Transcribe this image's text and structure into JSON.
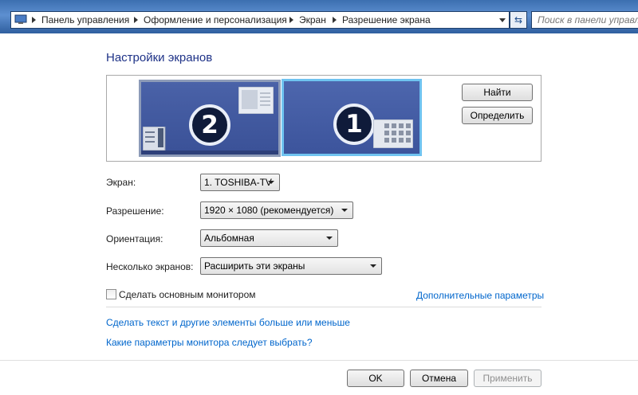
{
  "breadcrumb": {
    "items": [
      "Панель управления",
      "Оформление и персонализация",
      "Экран",
      "Разрешение экрана"
    ]
  },
  "search": {
    "placeholder": "Поиск в панели управле"
  },
  "page_title": "Настройки экранов",
  "monitors": {
    "monitor_2_number": "2",
    "monitor_1_number": "1",
    "find_label": "Найти",
    "identify_label": "Определить"
  },
  "settings": {
    "display_label": "Экран:",
    "display_value": "1. TOSHIBA-TV",
    "resolution_label": "Разрешение:",
    "resolution_value": "1920 × 1080 (рекомендуется)",
    "orientation_label": "Ориентация:",
    "orientation_value": "Альбомная",
    "multiple_label": "Несколько экранов:",
    "multiple_value": "Расширить эти экраны"
  },
  "primary_checkbox_label": "Сделать основным монитором",
  "advanced_link": "Дополнительные параметры",
  "links": {
    "text_size": "Сделать текст и другие элементы больше или меньше",
    "which_settings": "Какие параметры монитора следует выбрать?"
  },
  "buttons": {
    "ok": "OK",
    "cancel": "Отмена",
    "apply": "Применить"
  },
  "colors": {
    "link": "#0066cc",
    "title": "#1e3287",
    "selected_monitor_border": "#6fc3f0"
  }
}
